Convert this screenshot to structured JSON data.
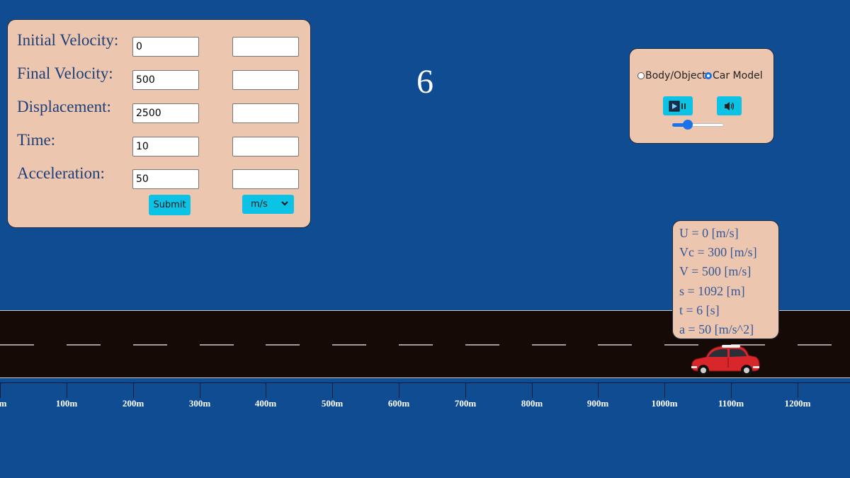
{
  "form": {
    "rows": [
      {
        "label": "Initial Velocity:",
        "value": "0",
        "result": ""
      },
      {
        "label": "Final Velocity:",
        "value": "500",
        "result": ""
      },
      {
        "label": "Displacement:",
        "value": "2500",
        "result": ""
      },
      {
        "label": "Time:",
        "value": "10",
        "result": ""
      },
      {
        "label": "Acceleration:",
        "value": "50",
        "result": ""
      }
    ],
    "submit_label": "Submit",
    "unit_selected": "m/s"
  },
  "timer": "6",
  "controls": {
    "radio_body": "Body/Object",
    "radio_car": "Car Model",
    "selected_mode": "Car Model",
    "volume": 0.25
  },
  "info": {
    "lines": [
      "U = 0 [m/s]",
      "Vc = 300 [m/s]",
      "V = 500 [m/s]",
      "s = 1092 [m]",
      "t = 6 [s]",
      "a = 50 [m/s^2]"
    ]
  },
  "ruler": {
    "labels": [
      "m",
      "100m",
      "200m",
      "300m",
      "400m",
      "500m",
      "600m",
      "700m",
      "800m",
      "900m",
      "1000m",
      "1100m",
      "1200m"
    ]
  },
  "colors": {
    "background": "#104c92",
    "panel": "#edc6b0",
    "button": "#0cc3e6",
    "road": "#150a05",
    "car": "#d9262b"
  }
}
